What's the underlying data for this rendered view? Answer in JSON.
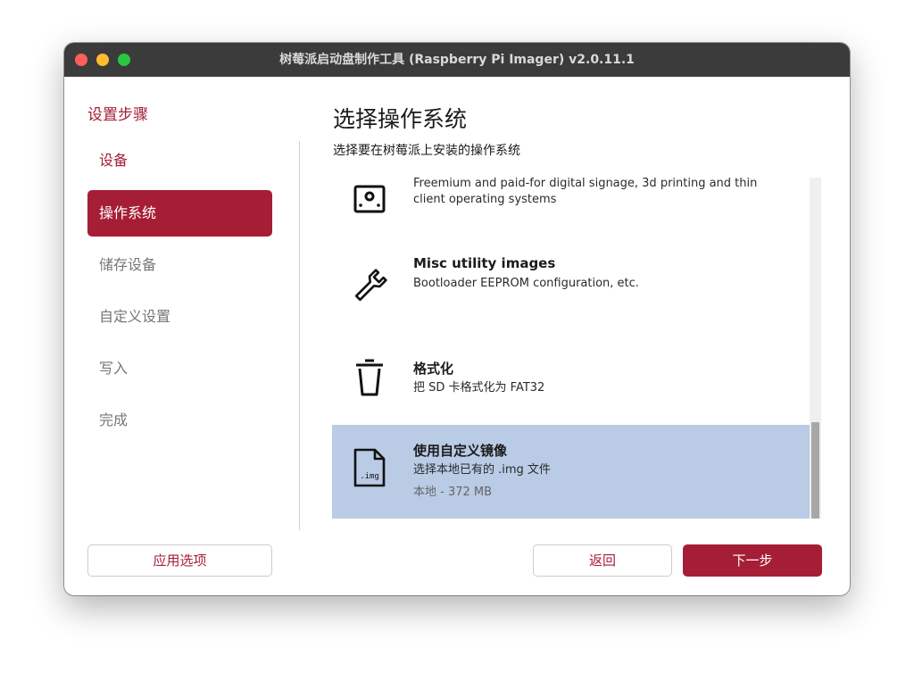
{
  "window": {
    "title": "树莓派启动盘制作工具 (Raspberry Pi Imager) v2.0.11.1"
  },
  "sidebar": {
    "heading": "设置步骤",
    "items": [
      {
        "label": "设备",
        "state": "done"
      },
      {
        "label": "操作系统",
        "state": "active"
      },
      {
        "label": "储存设备",
        "state": "pending"
      },
      {
        "label": "自定义设置",
        "state": "pending"
      },
      {
        "label": "写入",
        "state": "pending"
      },
      {
        "label": "完成",
        "state": "pending"
      }
    ],
    "options_button": "应用选项"
  },
  "main": {
    "title": "选择操作系统",
    "subtitle": "选择要在树莓派上安装的操作系统"
  },
  "os_list": [
    {
      "title": "",
      "description": "Freemium and paid-for digital signage, 3d printing and thin client operating systems",
      "icon": "signage-icon"
    },
    {
      "title": "Misc utility images",
      "description": "Bootloader EEPROM configuration, etc.",
      "icon": "wrench-icon"
    },
    {
      "title": "格式化",
      "description": "把 SD 卡格式化为 FAT32",
      "icon": "trash-icon"
    },
    {
      "title": "使用自定义镜像",
      "description": "选择本地已有的 .img 文件",
      "meta": "本地 - 372 MB",
      "icon": "img-file-icon",
      "icon_label": ".img",
      "selected": true
    }
  ],
  "buttons": {
    "back": "返回",
    "next": "下一步"
  },
  "colors": {
    "accent": "#a51e36",
    "selection": "#b9cbe5",
    "titlebar": "#3b3b3b"
  }
}
